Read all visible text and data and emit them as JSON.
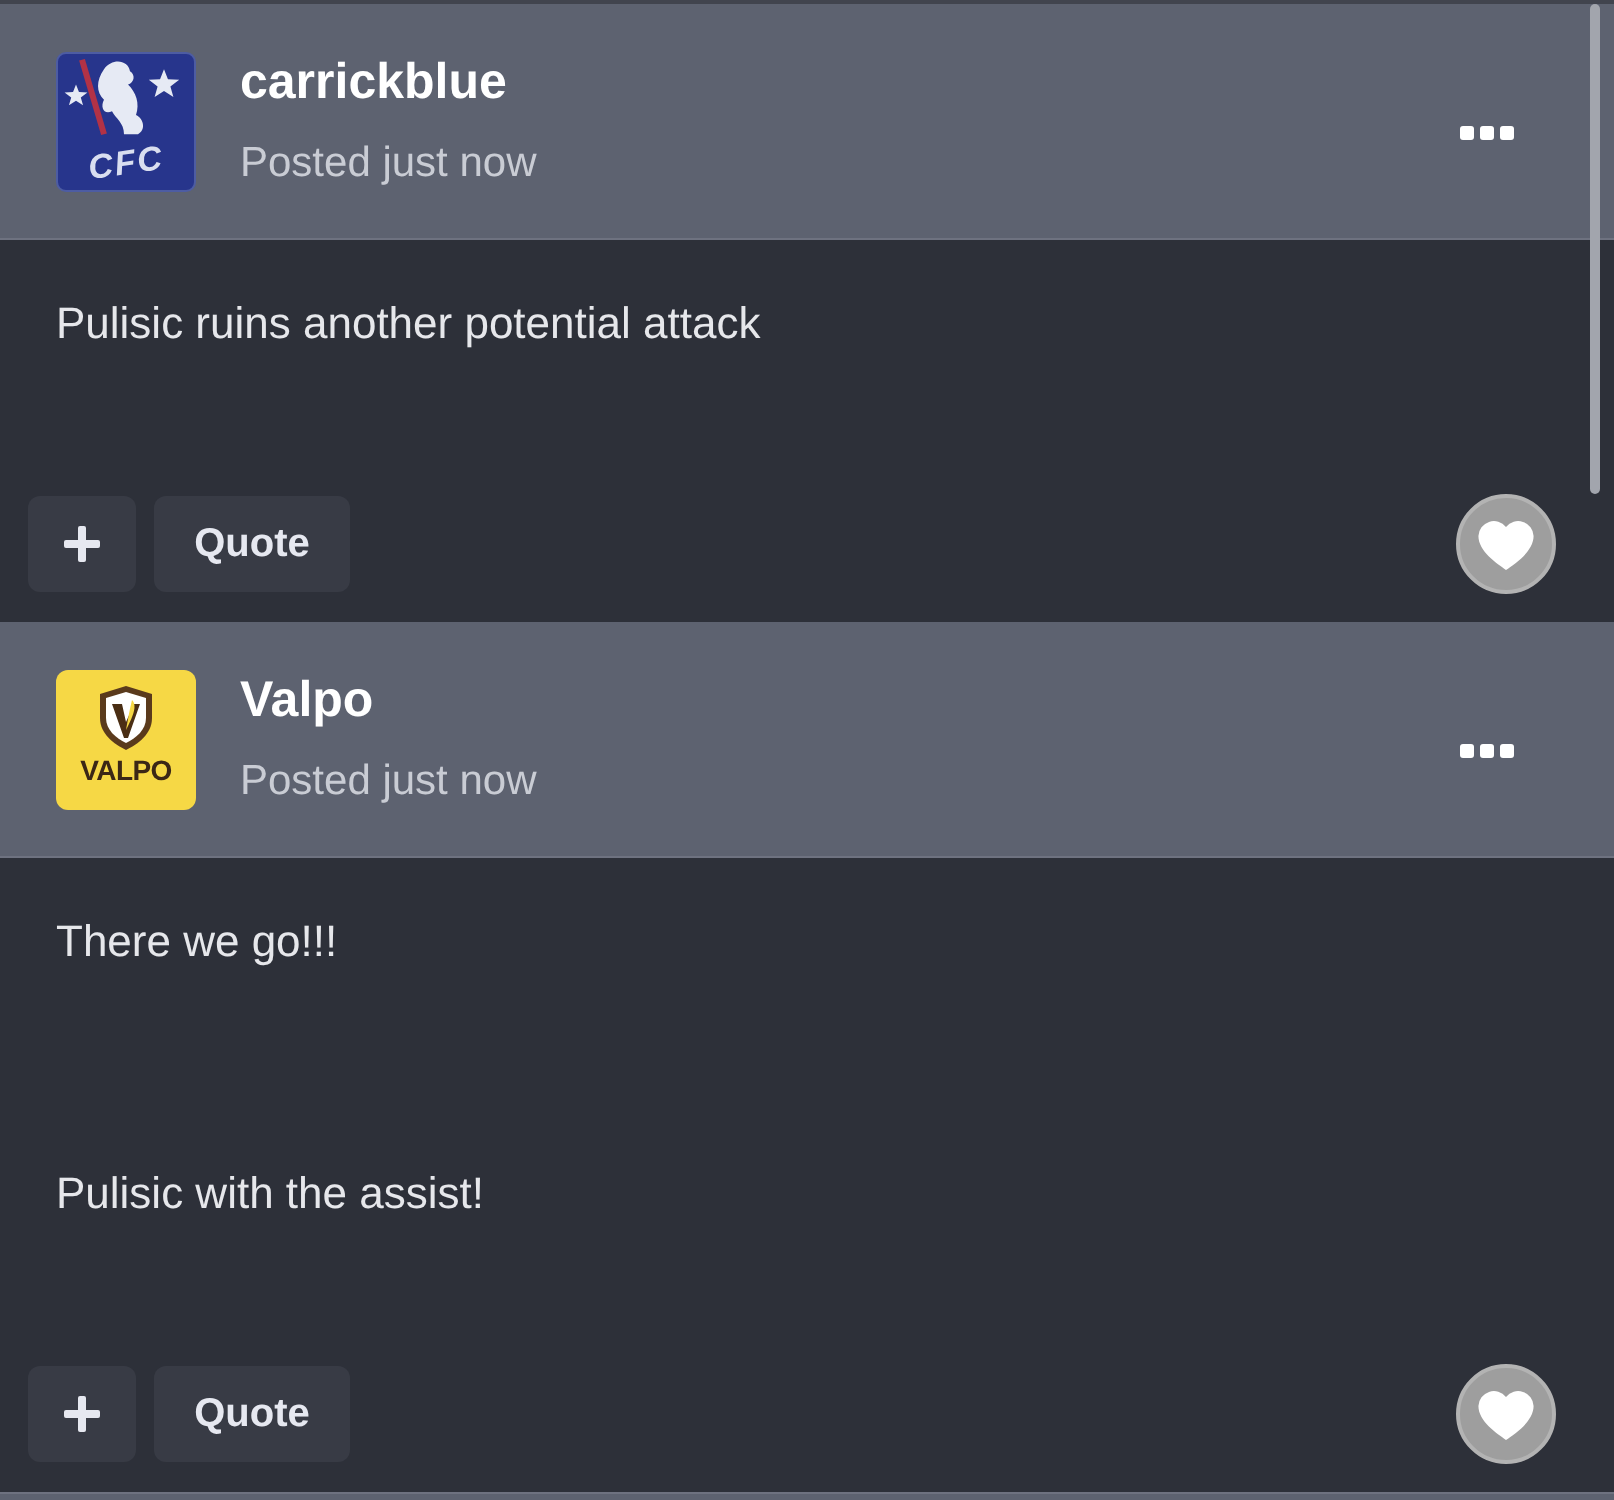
{
  "posts": [
    {
      "avatar": {
        "kind": "crest",
        "text": "CFC"
      },
      "author": "carrickblue",
      "time": "Posted just now",
      "paragraphs": [
        "Pulisic ruins another potential attack"
      ],
      "quote_label": "Quote"
    },
    {
      "avatar": {
        "kind": "shield",
        "text": "VALPO"
      },
      "author": "Valpo",
      "time": "Posted just now",
      "paragraphs": [
        "There we go!!!",
        "Pulisic with the assist!"
      ],
      "quote_label": "Quote"
    }
  ]
}
